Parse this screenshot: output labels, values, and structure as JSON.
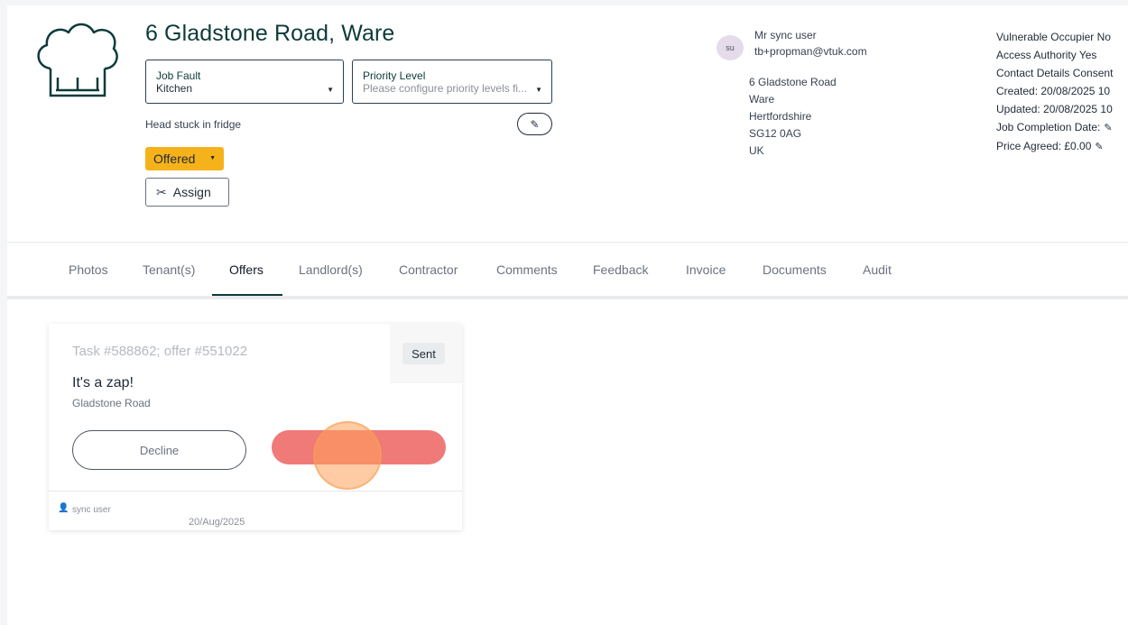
{
  "job": {
    "title": "6 Gladstone Road, Ware",
    "job_fault": {
      "label": "Job Fault",
      "value": "Kitchen"
    },
    "priority": {
      "label": "Priority Level",
      "placeholder": "Please configure priority levels fi..."
    },
    "description": "Head stuck in fridge",
    "status": "Offered",
    "assign_label": "Assign",
    "edit_icon": "pencil-icon"
  },
  "user": {
    "initials": "su",
    "name": "Mr sync user",
    "email": "tb+propman@vtuk.com"
  },
  "address": [
    "6 Gladstone Road",
    "Ware",
    "Hertfordshire",
    "SG12 0AG",
    "UK"
  ],
  "meta": {
    "vulnerable": "Vulnerable Occupier No",
    "access": "Access Authority Yes",
    "consent": "Contact Details Consent",
    "created": "Created: 20/08/2025 10",
    "updated": "Updated: 20/08/2025 10",
    "completion": "Job Completion Date:",
    "price": "Price Agreed: £0.00"
  },
  "tabs": [
    "Photos",
    "Tenant(s)",
    "Offers",
    "Landlord(s)",
    "Contractor",
    "Comments",
    "Feedback",
    "Invoice",
    "Documents",
    "Audit"
  ],
  "active_tab": "Offers",
  "offer_card": {
    "task": "Task #588862; offer #551022",
    "badge": "Sent",
    "title": "It's a zap!",
    "subtitle": "Gladstone Road",
    "decline_label": "Decline",
    "footer_user": "sync user",
    "footer_date": "20/Aug/2025"
  },
  "colors": {
    "brand": "#0d3b3a",
    "status": "#f6b21a",
    "accept": "#ef7a78"
  }
}
